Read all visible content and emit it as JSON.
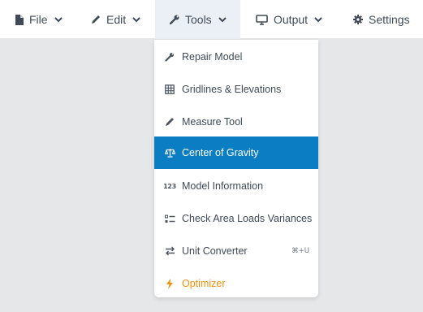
{
  "menubar": {
    "file": {
      "label": "File",
      "icon": "file-icon"
    },
    "edit": {
      "label": "Edit",
      "icon": "pencil-icon"
    },
    "tools": {
      "label": "Tools",
      "icon": "wrench-icon"
    },
    "output": {
      "label": "Output",
      "icon": "monitor-icon"
    },
    "settings": {
      "label": "Settings",
      "icon": "gear-icon"
    }
  },
  "tools_menu": {
    "items": [
      {
        "label": "Repair Model",
        "icon": "wrench-icon"
      },
      {
        "label": "Gridlines & Elevations",
        "icon": "grid-icon"
      },
      {
        "label": "Measure Tool",
        "icon": "ruler-icon"
      },
      {
        "label": "Center of Gravity",
        "icon": "balance-scale-icon",
        "selected": true
      },
      {
        "label": "Model Information",
        "icon": "number-123-icon",
        "icon_text": "123"
      },
      {
        "label": "Check Area Loads Variances",
        "icon": "checklist-icon"
      },
      {
        "label": "Unit Converter",
        "icon": "exchange-arrows-icon",
        "shortcut": "⌘+U"
      },
      {
        "label": "Optimizer",
        "icon": "bolt-icon"
      }
    ]
  },
  "colors": {
    "background": "#e6e7e9",
    "selected_item": "#0b7ec3",
    "optimizer_accent": "#f0920d",
    "text": "#3f4a56"
  }
}
